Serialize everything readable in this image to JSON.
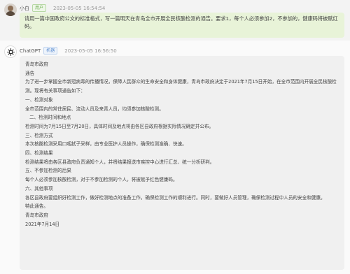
{
  "user_message": {
    "name": "小白",
    "role_badge": "用户",
    "timestamp": "2023-05-05 16:54:54",
    "text": "请用一篇中国政府公文的标准格式，写一篇明天在青岛全市开展全民核酸检测的通告。要求1，每个人必须参加2，不参加的，健康码将被赋红码。"
  },
  "ai_message": {
    "name": "ChatGPT",
    "role_badge": "机器",
    "timestamp": "2023-05-05 16:56:50",
    "lines": [
      "青岛市政府",
      "通告",
      "为了进一步掌握全市新冠病毒的传播情况，保障人民群众的生命安全和身体健康，青岛市政府决定于2021年7月15日开始，在全市范围内开展全民核酸检测。现将有关事项通告如下：",
      "一、检测对象",
      "全市范围内的常住居民、流动人员及来青人员，均须参加核酸检测。",
      "二、检测时间和地点",
      "检测时间为7月15日至7月20日，具体时间及地点将由各区县政府根据实际情况确定并公布。",
      "三、检测方式",
      "本次核酸检测采用口咽拭子采样，由专业医护人员操作，确保检测准确、快速。",
      "四、检测结果",
      "检测结果将由各区县政府负责通知个人，并将结果报送市疾控中心进行汇总、统一分析研判。",
      "五、不参加检测的后果",
      "每个人必须参加核酸检测，对于不参加检测的个人，将被赋予红色健康码。",
      "六、其他事项",
      "各区县政府要组织好检测工作，做好检测地点的准备工作，确保检测工作的顺利进行。同时，要做好人员管理，确保检测过程中人员的安全和健康。",
      "特此通告。",
      "青岛市政府",
      "2021年7月14日"
    ]
  }
}
